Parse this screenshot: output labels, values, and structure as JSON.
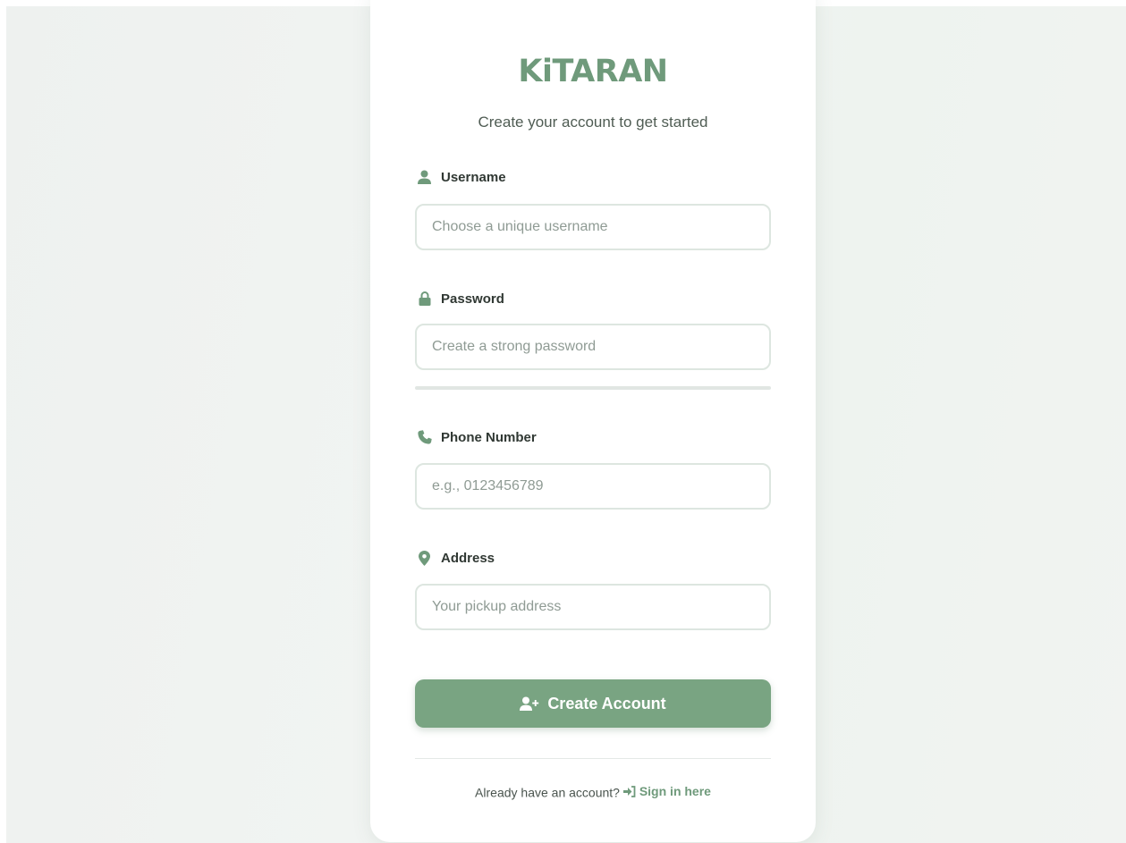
{
  "brand": {
    "name": "KiTARAN",
    "color": "#6f9a7b"
  },
  "subtitle": "Create your account to get started",
  "form": {
    "username": {
      "label": "Username",
      "icon": "user-icon",
      "value": "",
      "placeholder": "Choose a unique username"
    },
    "password": {
      "label": "Password",
      "icon": "lock-icon",
      "value": "",
      "placeholder": "Create a strong password",
      "strength": 0
    },
    "phone": {
      "label": "Phone Number",
      "icon": "phone-icon",
      "value": "",
      "placeholder": "e.g., 0123456789"
    },
    "address": {
      "label": "Address",
      "icon": "map-pin-icon",
      "value": "",
      "placeholder": "Your pickup address"
    }
  },
  "submit_button": {
    "label": "Create Account",
    "icon": "user-plus-icon",
    "color": "#79a482"
  },
  "footer": {
    "prompt": "Already have an account?",
    "link_label": "Sign in here",
    "link_icon": "sign-in-icon"
  }
}
